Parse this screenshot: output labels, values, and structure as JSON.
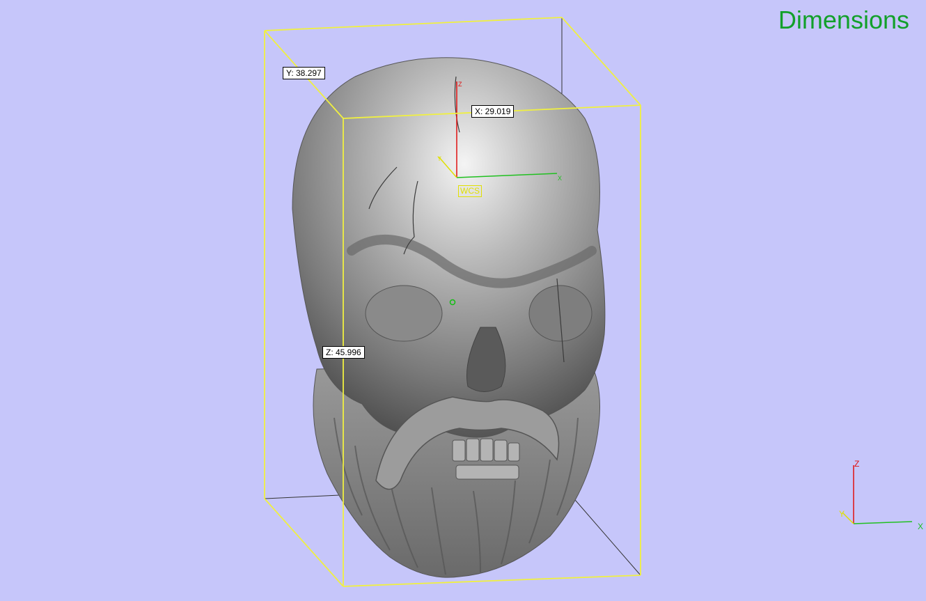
{
  "view": {
    "title": "Dimensions",
    "background": "#c6c6fa",
    "bounding_box_color": "#f0f040",
    "dimensions": {
      "x": "X: 29.019",
      "y": "Y: 38.297",
      "z": "Z: 45.996"
    },
    "wcs_label": "WCS",
    "model_name": "skull-icon"
  },
  "triad": {
    "x_label": "X",
    "y_label": "Y",
    "z_label": "Z",
    "x_color": "#20c020",
    "y_color": "#e0e000",
    "z_color": "#e01010"
  }
}
